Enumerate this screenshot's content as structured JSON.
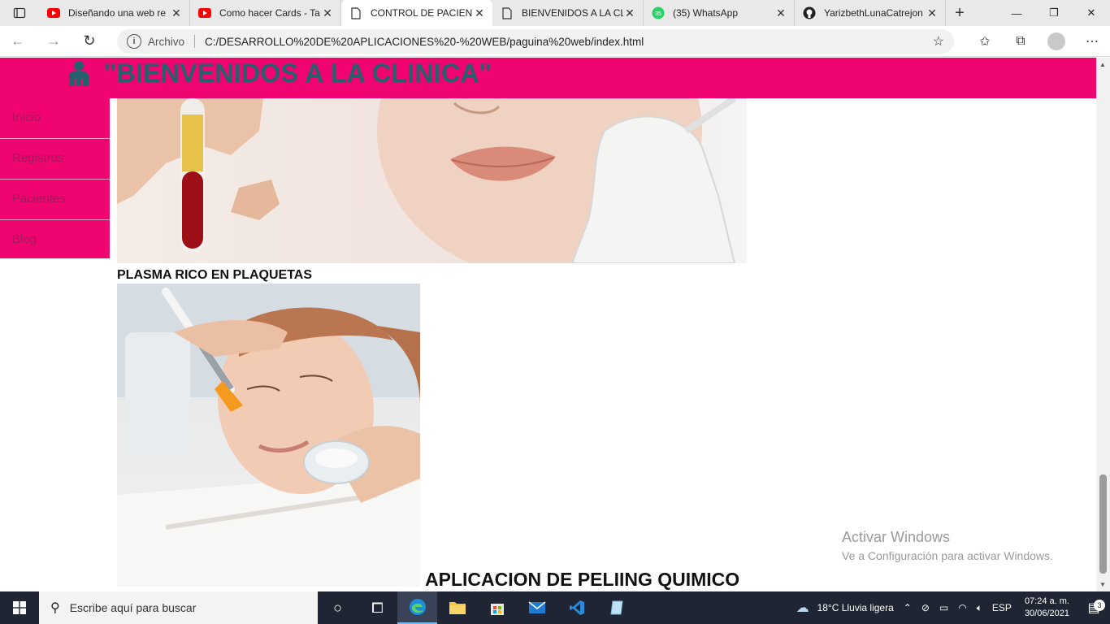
{
  "browser": {
    "tabs": [
      {
        "title": "Diseñando una web re",
        "icon": "youtube-icon"
      },
      {
        "title": "Como hacer Cards - Ta",
        "icon": "youtube-icon"
      },
      {
        "title": "CONTROL DE PACIENT",
        "icon": "page-icon",
        "active": true
      },
      {
        "title": "BIENVENIDOS A LA CL",
        "icon": "page-icon"
      },
      {
        "title": "(35) WhatsApp",
        "icon": "whatsapp-icon"
      },
      {
        "title": "YarizbethLunaCatrejon",
        "icon": "github-icon"
      }
    ],
    "close_glyph": "✕",
    "new_tab_glyph": "+",
    "origin_label": "Archivo",
    "url": "C:/DESARROLLO%20DE%20APLICACIONES%20-%20WEB/paguina%20web/index.html"
  },
  "site": {
    "title": "\"BIENVENIDOS A LA CLINICA\"",
    "nav": [
      "Inicio",
      "Registros",
      "Pacientes",
      "Blog"
    ],
    "caption_1": "PLASMA RICO EN PLAQUETAS",
    "caption_2": "APLICACION DE PELIING QUIMICO",
    "colors": {
      "header_bg": "#f0046f",
      "title_color": "#27606d",
      "nav_text": "#a3195a"
    }
  },
  "watermark": {
    "line1": "Activar Windows",
    "line2": "Ve a Configuración para activar Windows."
  },
  "taskbar": {
    "search_placeholder": "Escribe aquí para buscar",
    "weather": "18°C  Lluvia ligera",
    "language": "ESP",
    "time": "07:24 a. m.",
    "date": "30/06/2021",
    "notification_count": "3"
  }
}
